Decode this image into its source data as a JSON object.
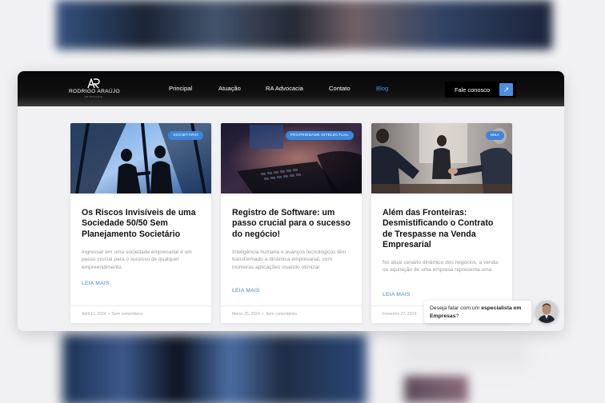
{
  "brand": {
    "name": "RODRIGO ARAÚJO",
    "sub": "ADVOCACIA"
  },
  "nav": {
    "items": [
      {
        "label": "Principal"
      },
      {
        "label": "Atuação"
      },
      {
        "label": "RA Advocacia"
      },
      {
        "label": "Contato"
      },
      {
        "label": "Blog",
        "active": true
      }
    ],
    "cta_label": "Fale conosco",
    "cta_icon": "arrow-up-right-icon"
  },
  "posts": [
    {
      "badge": "SOCIETÁRIO",
      "title": "Os Riscos Invisíveis de uma Sociedade 50/50 Sem Planejamento Societário",
      "excerpt": "Ingressar em uma sociedade empresarial é um passo crucial para o sucesso de qualquer empreendimento.",
      "read_more": "LEIA MAIS",
      "date": "Abril 11, 2024",
      "comments": "Sem comentários"
    },
    {
      "badge": "PROPRIEDADE INTELECTUAL",
      "title": "Registro de Software: um passo crucial para o sucesso do negócio!",
      "excerpt": "Inteligência humana e avanços tecnológicos têm transformado a dinâmica empresarial, com inúmeras aplicações visando otimizar",
      "read_more": "LEIA MAIS",
      "date": "Março 25, 2024",
      "comments": "Sem comentários"
    },
    {
      "badge": "M&A",
      "title": "Além das Fronteiras: Desmistificando o Contrato de Trespasse na Venda Empresarial",
      "excerpt": "No atual cenário dinâmico dos negócios, a venda ou aquisição de uma empresa representa uma",
      "read_more": "LEIA MAIS",
      "date": "Fevereiro 27, 2024",
      "comments": ""
    }
  ],
  "chat": {
    "text_prefix": "Deseja falar com um",
    "text_bold": "especialista em Empresas",
    "text_suffix": "?"
  },
  "colors": {
    "accent": "#3d86dc",
    "nav_active": "#4d8fe0",
    "title": "#111111",
    "muted": "#9a9a9a"
  }
}
